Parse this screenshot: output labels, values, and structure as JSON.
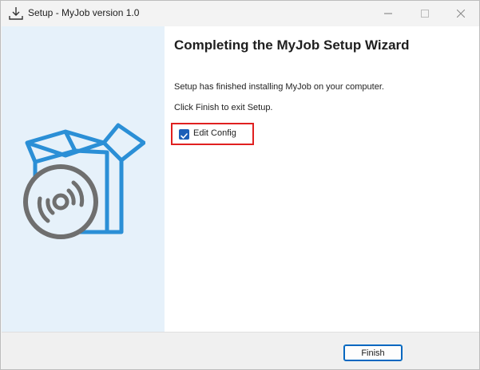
{
  "window": {
    "title": "Setup - MyJob version 1.0",
    "controls": [
      "minimize-icon",
      "maximize-icon",
      "close-icon"
    ]
  },
  "wizard": {
    "heading": "Completing the MyJob Setup Wizard",
    "message1": "Setup has finished installing MyJob on your computer.",
    "message2": "Click Finish to exit Setup.",
    "option": {
      "label": "Edit Config",
      "checked": true
    },
    "finish_label": "Finish"
  },
  "colors": {
    "accent": "#0067c0",
    "side_panel": "#e6f1fa",
    "highlight": "#e02020",
    "box_blue": "#2b8fd6"
  }
}
